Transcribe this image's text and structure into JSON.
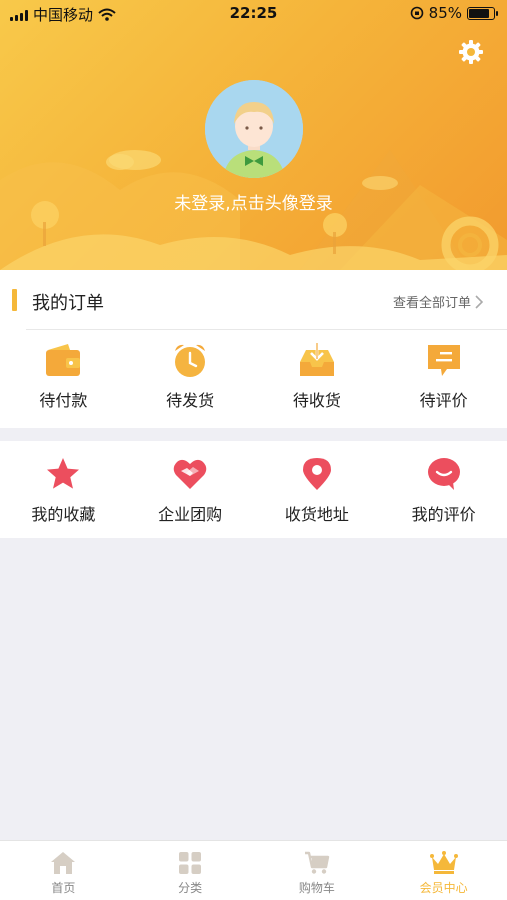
{
  "status_bar": {
    "carrier": "中国移动",
    "time": "22:25",
    "battery": "85%",
    "battery_level": 0.85
  },
  "profile": {
    "login_prompt": "未登录,点击头像登录"
  },
  "orders": {
    "title": "我的订单",
    "view_all": "查看全部订单",
    "items": [
      {
        "label": "待付款",
        "icon": "wallet-icon"
      },
      {
        "label": "待发货",
        "icon": "alarm-clock-icon"
      },
      {
        "label": "待收货",
        "icon": "inbox-download-icon"
      },
      {
        "label": "待评价",
        "icon": "comment-icon"
      }
    ]
  },
  "services": {
    "items": [
      {
        "label": "我的收藏",
        "icon": "star-icon"
      },
      {
        "label": "企业团购",
        "icon": "handshake-heart-icon"
      },
      {
        "label": "收货地址",
        "icon": "location-pin-icon"
      },
      {
        "label": "我的评价",
        "icon": "speech-bubble-icon"
      }
    ]
  },
  "tabbar": {
    "items": [
      {
        "label": "首页",
        "icon": "home-icon",
        "active": false
      },
      {
        "label": "分类",
        "icon": "grid-icon",
        "active": false
      },
      {
        "label": "购物车",
        "icon": "cart-icon",
        "active": false
      },
      {
        "label": "会员中心",
        "icon": "crown-icon",
        "active": true
      }
    ]
  },
  "colors": {
    "accent": "#f5b83a",
    "header_start": "#f8c94a",
    "header_end": "#f29a2e",
    "service_red": "#ec4e5e",
    "background": "#efeff4"
  }
}
